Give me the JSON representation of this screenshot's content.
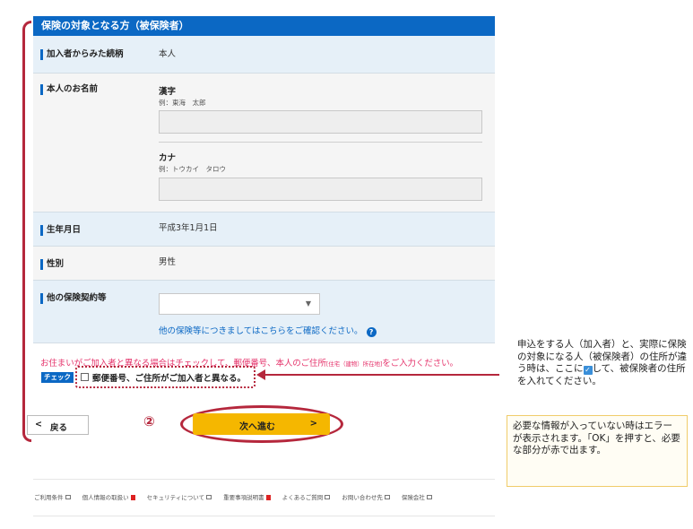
{
  "section": {
    "title": "保険の対象となる方（被保険者）"
  },
  "fields": {
    "relationship": {
      "label": "加入者からみた続柄",
      "value": "本人"
    },
    "name": {
      "label": "本人のお名前",
      "kanji": {
        "label": "漢字",
        "example": "例：東海　太郎",
        "value": ""
      },
      "kana": {
        "label": "カナ",
        "example": "例：トウカイ　タロウ",
        "value": ""
      }
    },
    "birthdate": {
      "label": "生年月日",
      "value": "平成3年1月1日"
    },
    "gender": {
      "label": "性別",
      "value": "男性"
    },
    "other_insurance": {
      "label": "他の保険契約等",
      "selected": "",
      "info_link": "他の保険等につきましてはこちらをご確認ください。",
      "help_icon": "question-icon"
    }
  },
  "address": {
    "notice_main": "お住まいがご加入者と異なる場合はチェックして、郵便番号、本人のご住所",
    "notice_small": "[住宅（建物）所在地]",
    "notice_end": "をご入力ください。",
    "badge": "チェック",
    "checkbox_label": "郵便番号、ご住所がご加入者と異なる。",
    "checked": false
  },
  "buttons": {
    "back": "戻る",
    "next": "次へ進む",
    "step_marker": "②"
  },
  "footer": {
    "links": [
      "ご利用条件",
      "個人情報の取扱い",
      "セキュリティについて",
      "重要事項説明書",
      "よくあるご質問",
      "お問い合わせ先",
      "保険会社"
    ]
  },
  "annotations": {
    "note1_a": "申込をする人（加入者）と、実際に保険の対象になる人（被保険者）の住所が違う時は、ここに",
    "note1_b": "して、被保険者の住所を入れてください。",
    "note2": "必要な情報が入っていない時はエラーが表示されます。「OK」を押すと、必要な部分が赤で出ます。"
  },
  "colors": {
    "header_blue": "#0b68c4",
    "accent_red": "#b5273c",
    "notice_pink": "#e5336b",
    "next_button": "#f5b700"
  }
}
